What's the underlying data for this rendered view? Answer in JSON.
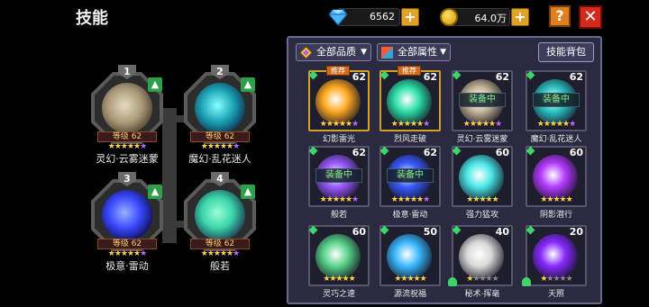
{
  "header": {
    "title": "技能"
  },
  "resources": {
    "gems": "6562",
    "coins": "64.0万",
    "gem_plus": "+",
    "coin_plus": "+"
  },
  "buttons": {
    "help": "?",
    "close": "✕",
    "bag": "技能背包"
  },
  "filters": {
    "quality": "全部品质",
    "attribute": "全部属性"
  },
  "slots": [
    {
      "num": "1",
      "level": "等级 62",
      "name": "灵幻·云雾迷蒙",
      "color": "#c8b89a"
    },
    {
      "num": "2",
      "level": "等级 62",
      "name": "魔幻·乱花迷人",
      "color": "#2ec4c4"
    },
    {
      "num": "3",
      "level": "等级 62",
      "name": "极意·雷动",
      "color": "#4a6aff"
    },
    {
      "num": "4",
      "level": "等级 62",
      "name": "般若",
      "color": "#3ad4a8"
    }
  ],
  "cards": [
    {
      "lv": "62",
      "tag": "推荐",
      "equip": "",
      "name": "幻影雷光",
      "color": "#ffaa22",
      "rating": "5+1"
    },
    {
      "lv": "62",
      "tag": "推荐",
      "equip": "",
      "name": "烈风走破",
      "color": "#2ee0a8",
      "rating": "5+1"
    },
    {
      "lv": "62",
      "tag": "",
      "equip": "装备中",
      "name": "灵幻·云雾迷蒙",
      "color": "#c8b89a",
      "rating": "5+1"
    },
    {
      "lv": "62",
      "tag": "",
      "equip": "装备中",
      "name": "魔幻·乱花迷人",
      "color": "#2ec4c4",
      "rating": "5+1"
    },
    {
      "lv": "62",
      "tag": "",
      "equip": "装备中",
      "name": "般若",
      "color": "#9a5aff",
      "rating": "5+1"
    },
    {
      "lv": "62",
      "tag": "",
      "equip": "装备中",
      "name": "极意·雷动",
      "color": "#3a5aff",
      "rating": "5+1"
    },
    {
      "lv": "60",
      "tag": "",
      "equip": "",
      "name": "强力猛攻",
      "color": "#4ae8e8",
      "rating": "5"
    },
    {
      "lv": "60",
      "tag": "",
      "equip": "",
      "name": "阴影潜行",
      "color": "#b43aff",
      "rating": "5"
    },
    {
      "lv": "60",
      "tag": "",
      "equip": "",
      "name": "灵巧之速",
      "color": "#5ad48a",
      "rating": "5"
    },
    {
      "lv": "50",
      "tag": "",
      "equip": "",
      "name": "源流祝福",
      "color": "#3ab8ff",
      "rating": "5"
    },
    {
      "lv": "40",
      "tag": "",
      "equip": "",
      "name": "秘术·挥毫",
      "color": "#d8d8d8",
      "rating": "1"
    },
    {
      "lv": "20",
      "tag": "",
      "equip": "",
      "name": "天照",
      "color": "#8a2aff",
      "rating": "1"
    }
  ]
}
